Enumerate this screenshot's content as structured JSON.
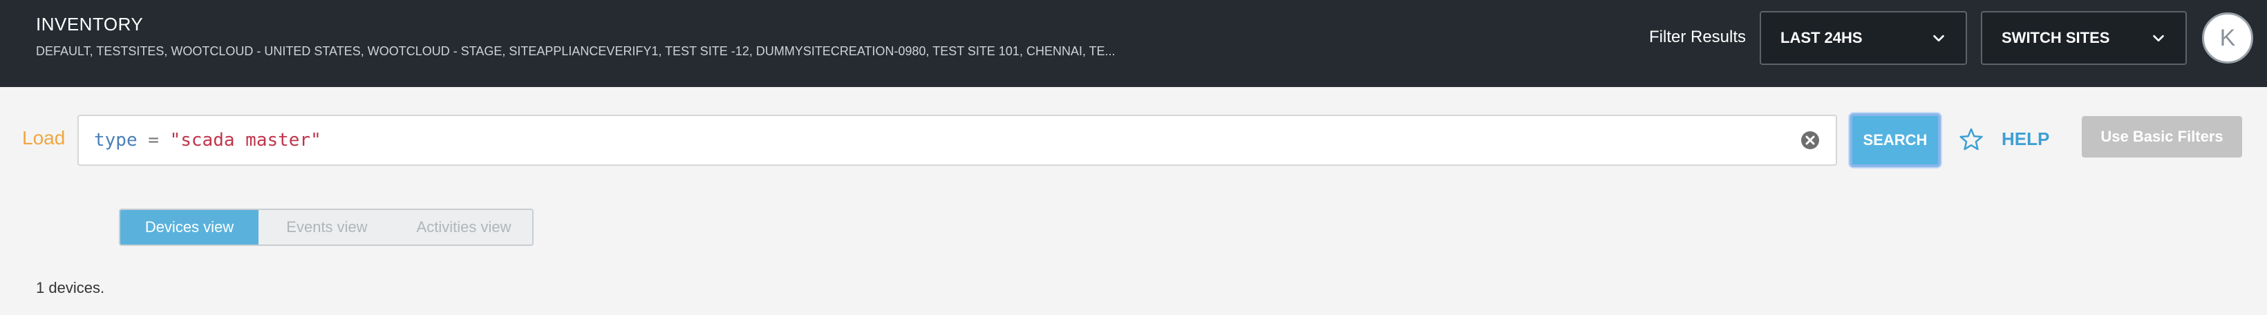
{
  "header": {
    "title": "INVENTORY",
    "sites": "DEFAULT, TESTSITES, WOOTCLOUD - UNITED STATES, WOOTCLOUD - STAGE, SITEAPPLIANCEVERIFY1, TEST SITE -12, DUMMYSITECREATION-0980, TEST SITE 101, CHENNAI, TE...",
    "filter_label": "Filter Results",
    "time_filter": "LAST 24HS",
    "switch_sites": "SWITCH SITES",
    "avatar_initial": "K"
  },
  "search": {
    "load_label": "Load",
    "query": {
      "key": "type",
      "operator": " = ",
      "value": "\"scada master\""
    },
    "search_label": "SEARCH",
    "help_label": "HELP",
    "basic_filters_label": "Use Basic Filters"
  },
  "views": {
    "tabs": [
      {
        "label": "Devices view",
        "active": true
      },
      {
        "label": "Events view",
        "active": false
      },
      {
        "label": "Activities view",
        "active": false
      }
    ]
  },
  "results": {
    "count_text": "1 devices."
  },
  "colors": {
    "header_bg": "#252b31",
    "accent_blue": "#54b3e0",
    "load_orange": "#f0a640",
    "help_blue": "#3e9fd3"
  },
  "icons": [
    "chevron-down-icon",
    "clear-icon",
    "star-icon"
  ]
}
